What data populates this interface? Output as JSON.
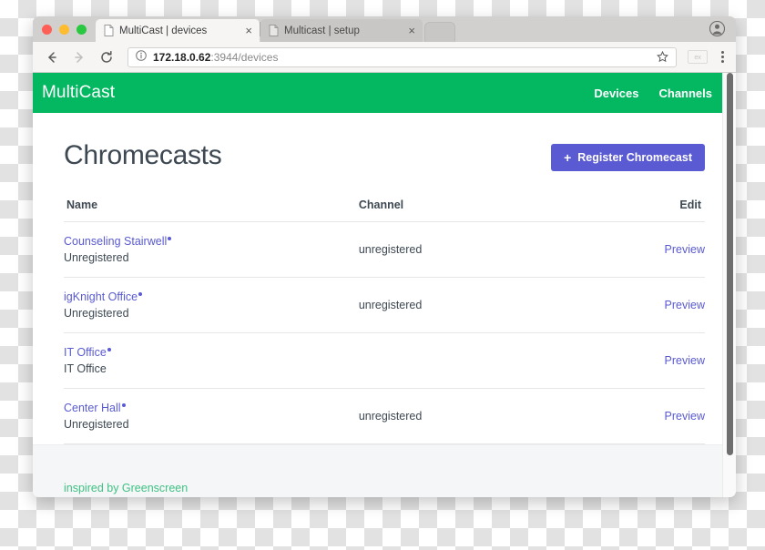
{
  "browser": {
    "tabs": [
      {
        "title": "MultiCast | devices",
        "favicon": "page-icon",
        "active": true,
        "close_label": "×"
      },
      {
        "title": "Multicast | setup",
        "favicon": "page-icon",
        "active": false,
        "close_label": "×"
      }
    ],
    "toolbar": {
      "back_icon": "back-arrow-icon",
      "forward_icon": "forward-arrow-icon",
      "reload_icon": "reload-icon",
      "info_icon": "info-circle-icon",
      "url_host": "172.18.0.62",
      "url_rest": ":3944/devices",
      "bookmark_icon": "star-icon",
      "extension_label": "ex",
      "menu_icon": "three-dot-menu-icon"
    },
    "profile_icon": "profile-avatar-icon",
    "traffic_lights": [
      "close",
      "minimize",
      "maximize"
    ]
  },
  "site": {
    "brand": "MultiCast",
    "nav_links": [
      {
        "label": "Devices"
      },
      {
        "label": "Channels"
      }
    ],
    "accent_green": "#04b862",
    "accent_indigo": "#5a5ad2",
    "footer_green": "#3fc184"
  },
  "page": {
    "title": "Chromecasts",
    "register_button": {
      "plus": "+",
      "label": "Register Chromecast"
    },
    "table": {
      "headers": {
        "name": "Name",
        "channel": "Channel",
        "edit": "Edit"
      },
      "rows": [
        {
          "name": "Counseling Stairwell",
          "subtitle": "Unregistered",
          "channel": "unregistered",
          "edit_label": "Preview"
        },
        {
          "name": "igKnight Office",
          "subtitle": "Unregistered",
          "channel": "unregistered",
          "edit_label": "Preview"
        },
        {
          "name": "IT Office",
          "subtitle": "IT Office",
          "channel": "",
          "edit_label": "Preview"
        },
        {
          "name": "Center Hall",
          "subtitle": "Unregistered",
          "channel": "unregistered",
          "edit_label": "Preview"
        }
      ]
    }
  },
  "footer": {
    "link_label": "inspired by Greenscreen"
  }
}
